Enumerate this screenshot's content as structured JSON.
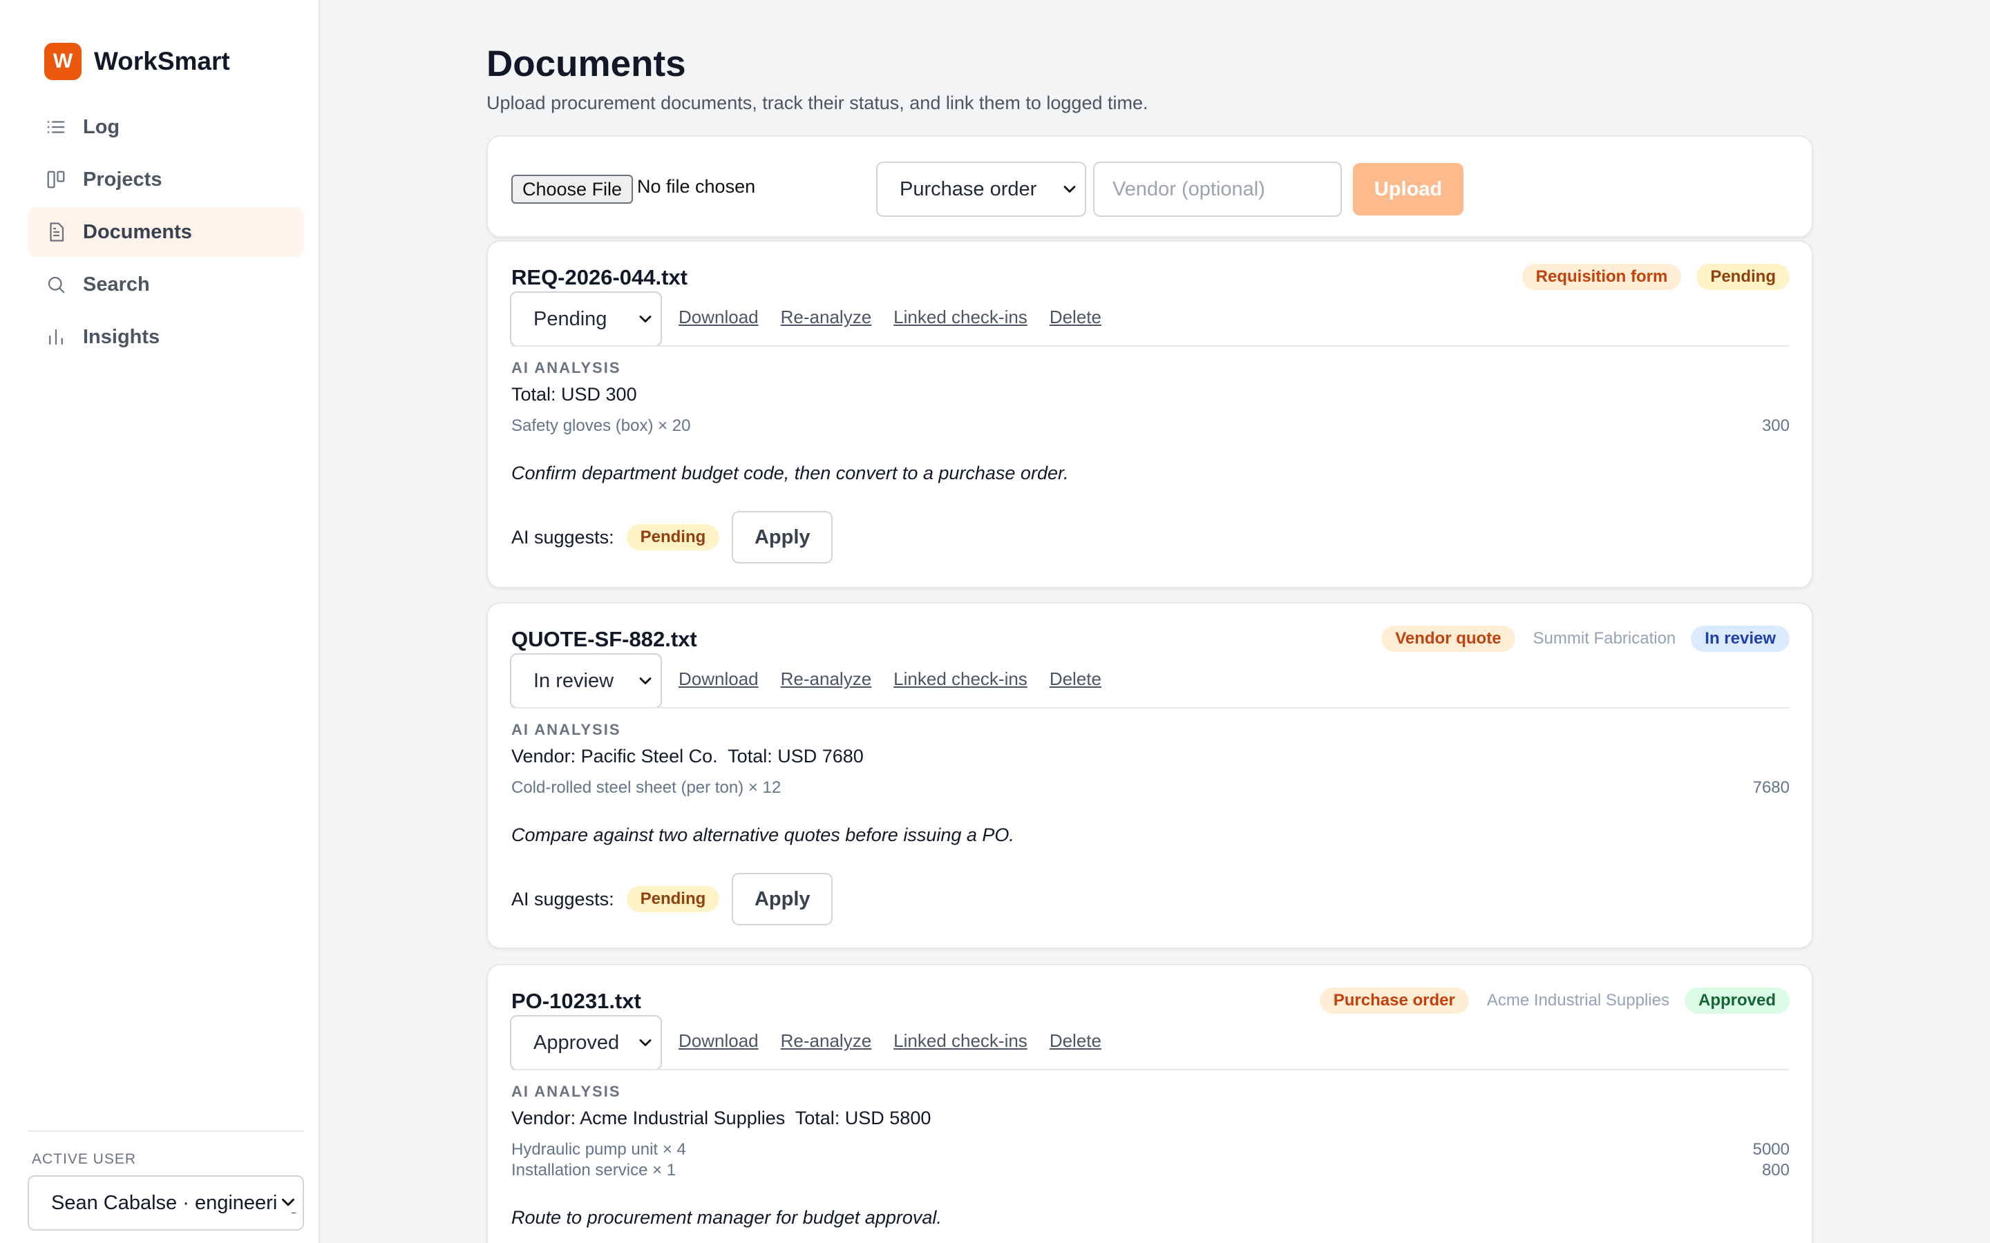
{
  "app": {
    "logo_letter": "W",
    "name": "WorkSmart"
  },
  "sidebar": {
    "items": [
      {
        "label": "Log",
        "icon": "list-icon",
        "active": false
      },
      {
        "label": "Projects",
        "icon": "board-icon",
        "active": false
      },
      {
        "label": "Documents",
        "icon": "document-icon",
        "active": true
      },
      {
        "label": "Search",
        "icon": "search-icon",
        "active": false
      },
      {
        "label": "Insights",
        "icon": "bar-chart-icon",
        "active": false
      }
    ],
    "active_user_label": "ACTIVE USER",
    "active_user_value": "Sean Cabalse · engineering"
  },
  "page": {
    "title": "Documents",
    "subtitle": "Upload procurement documents, track their status, and link them to logged time."
  },
  "upload": {
    "file_button": "Choose File",
    "file_status": "No file chosen",
    "doc_type": "Purchase order",
    "vendor_placeholder": "Vendor (optional)",
    "upload_button": "Upload"
  },
  "actions": {
    "download": "Download",
    "reanalyze": "Re-analyze",
    "linked": "Linked check-ins",
    "delete": "Delete",
    "ai_label": "AI ANALYSIS",
    "suggest_label": "AI suggests:",
    "apply": "Apply"
  },
  "documents": [
    {
      "name": "REQ-2026-044.txt",
      "type": "Requisition form",
      "vendor": "",
      "status": "Pending",
      "status_select": "Pending",
      "summary": "Total: USD 300",
      "items": [
        {
          "desc": "Safety gloves (box) × 20",
          "amount": "300"
        }
      ],
      "note": "Confirm department budget code, then convert to a purchase order.",
      "suggested": "Pending"
    },
    {
      "name": "QUOTE-SF-882.txt",
      "type": "Vendor quote",
      "vendor": "Summit Fabrication",
      "status": "In review",
      "status_select": "In review",
      "summary": "Vendor: Pacific Steel Co.  Total: USD 7680",
      "items": [
        {
          "desc": "Cold-rolled steel sheet (per ton) × 12",
          "amount": "7680"
        }
      ],
      "note": "Compare against two alternative quotes before issuing a PO.",
      "suggested": "Pending"
    },
    {
      "name": "PO-10231.txt",
      "type": "Purchase order",
      "vendor": "Acme Industrial Supplies",
      "status": "Approved",
      "status_select": "Approved",
      "summary": "Vendor: Acme Industrial Supplies  Total: USD 5800",
      "items": [
        {
          "desc": "Hydraulic pump unit × 4",
          "amount": "5000"
        },
        {
          "desc": "Installation service × 1",
          "amount": "800"
        }
      ],
      "note": "Route to procurement manager for budget approval.",
      "suggested": ""
    }
  ]
}
